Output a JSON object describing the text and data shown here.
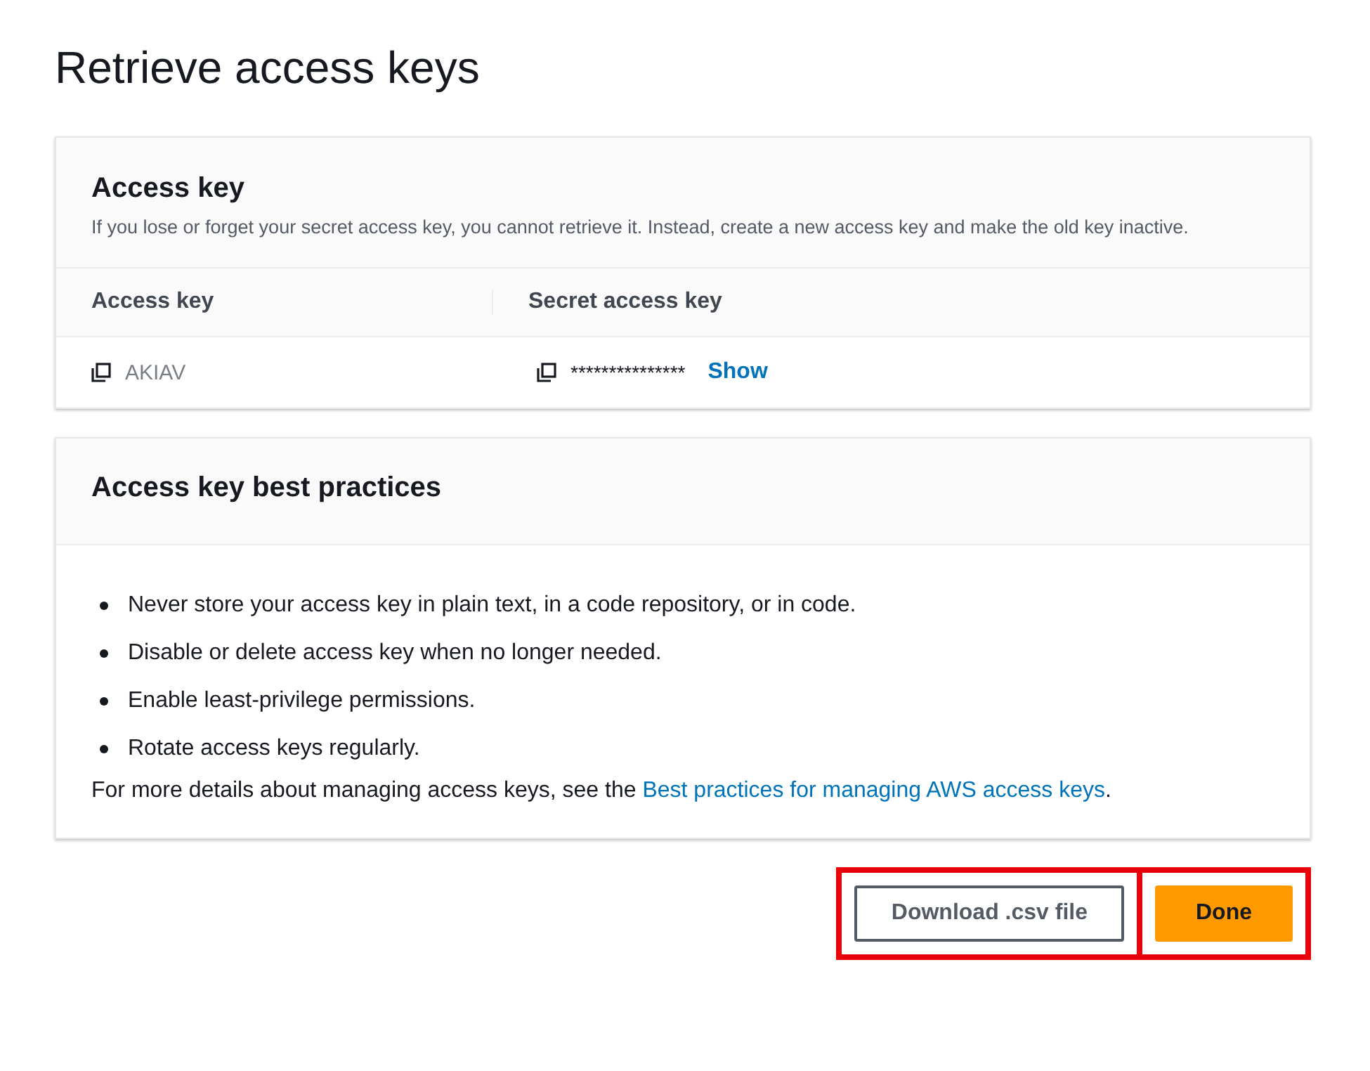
{
  "title": "Retrieve access keys",
  "access_key_panel": {
    "heading": "Access key",
    "description": "If you lose or forget your secret access key, you cannot retrieve it. Instead, create a new access key and make the old key inactive.",
    "columns": [
      "Access key",
      "Secret access key"
    ],
    "row": {
      "access_key": "AKIAV",
      "secret_key": "***************",
      "show_link": "Show"
    }
  },
  "best_practices_panel": {
    "heading": "Access key best practices",
    "items": [
      "Never store your access key in plain text, in a code repository, or in code.",
      "Disable or delete access key when no longer needed.",
      "Enable least-privilege permissions.",
      "Rotate access keys regularly."
    ],
    "footer_text": "For more details about managing access keys, see the ",
    "footer_link": "Best practices for managing AWS access keys",
    "footer_end": "."
  },
  "buttons": [
    {
      "label": "Download .csv file",
      "kind": "secondary",
      "highlighted": true
    },
    {
      "label": "Done",
      "kind": "primary",
      "highlighted": true
    }
  ]
}
